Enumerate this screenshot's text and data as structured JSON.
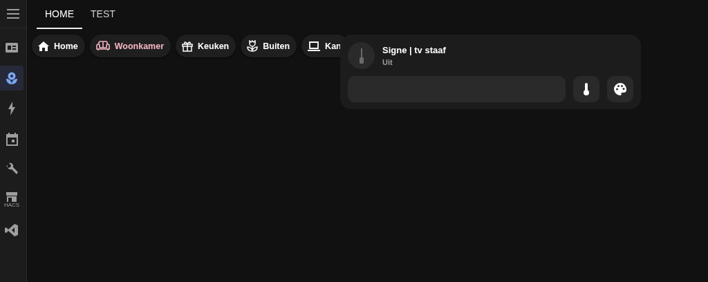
{
  "sidebar": {
    "items": [
      {
        "kind": "overview",
        "selected": false
      },
      {
        "kind": "flower",
        "selected": true
      },
      {
        "kind": "energy",
        "selected": false
      },
      {
        "kind": "calendar",
        "selected": false
      },
      {
        "kind": "wrench",
        "selected": false
      },
      {
        "kind": "hacs",
        "label": "HACS",
        "selected": false
      },
      {
        "kind": "vscode",
        "selected": false
      }
    ]
  },
  "tabs": [
    {
      "label": "HOME",
      "selected": true
    },
    {
      "label": "TEST",
      "selected": false
    }
  ],
  "chips": [
    {
      "kind": "home",
      "label": "Home",
      "selected": false
    },
    {
      "kind": "sofa",
      "label": "Woonkamer",
      "selected": true
    },
    {
      "kind": "gift",
      "label": "Keuken",
      "selected": false
    },
    {
      "kind": "tulip",
      "label": "Buiten",
      "selected": false
    },
    {
      "kind": "laptop",
      "label": "Kan",
      "selected": false
    }
  ],
  "card": {
    "title": "Signe | tv staaf",
    "state": "Uit",
    "on": false,
    "level": 0,
    "buttons": [
      {
        "kind": "thermometer"
      },
      {
        "kind": "palette"
      }
    ]
  }
}
